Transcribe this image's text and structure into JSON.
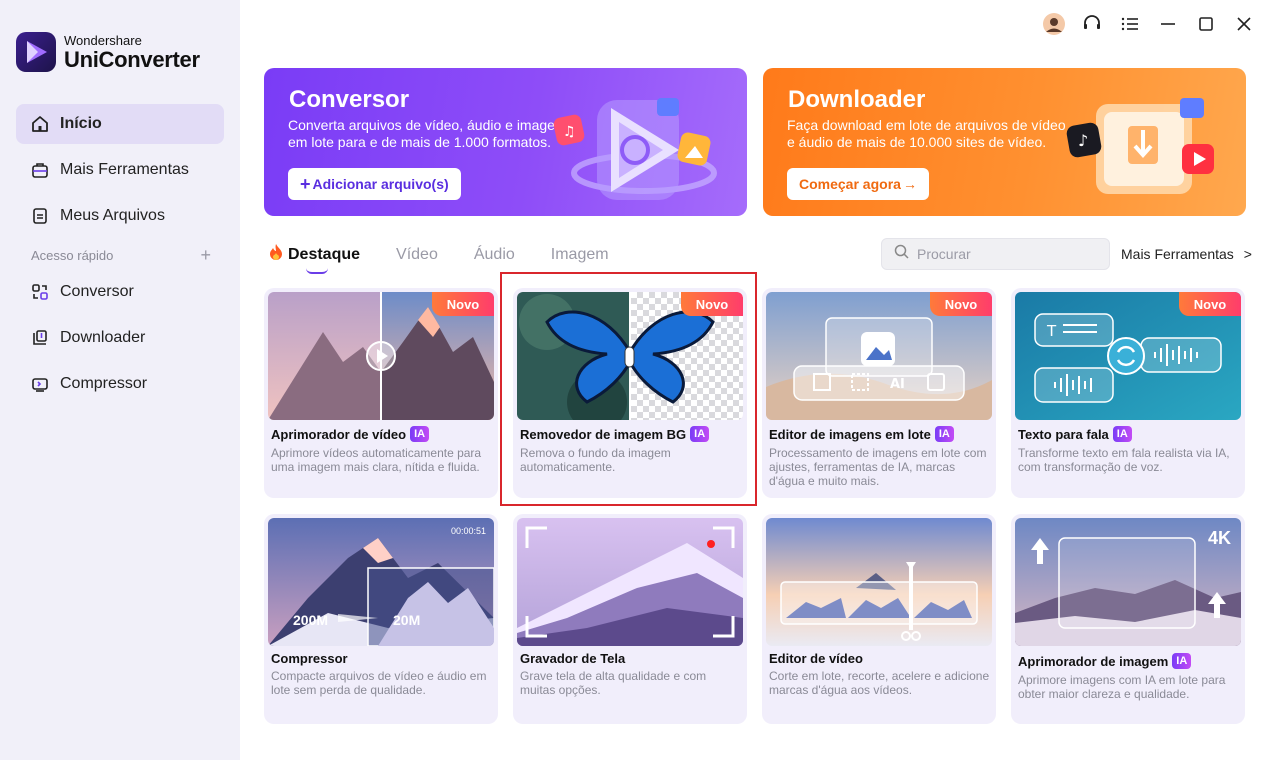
{
  "app": {
    "brand_small": "Wondershare",
    "brand_big": "UniConverter"
  },
  "sidebar": {
    "items": [
      {
        "label": "Início",
        "icon": "home-icon"
      },
      {
        "label": "Mais Ferramentas",
        "icon": "toolbox-icon"
      },
      {
        "label": "Meus Arquivos",
        "icon": "file-icon"
      }
    ],
    "quick_access_label": "Acesso rápido",
    "quick_access_add": "+",
    "quick_items": [
      {
        "label": "Conversor",
        "icon": "convert-icon"
      },
      {
        "label": "Downloader",
        "icon": "download-icon"
      },
      {
        "label": "Compressor",
        "icon": "compress-icon"
      }
    ]
  },
  "banners": {
    "converter": {
      "title": "Conversor",
      "description": "Converta arquivos de vídeo, áudio e imagem em lote para e de mais de 1.000 formatos.",
      "button": "Adicionar arquivo(s)"
    },
    "downloader": {
      "title": "Downloader",
      "description": "Faça download em lote de arquivos de vídeo e áudio de mais de 10.000 sites de vídeo.",
      "button": "Começar agora"
    }
  },
  "tabs": [
    "Destaque",
    "Vídeo",
    "Áudio",
    "Imagem"
  ],
  "search": {
    "placeholder": "Procurar"
  },
  "more_tools": "Mais Ferramentas",
  "badges": {
    "new": "Novo",
    "ai": "IA",
    "timer": "00:00:51",
    "size_before": "200M",
    "size_after": "20M",
    "res": "4K"
  },
  "cards": [
    {
      "title": "Aprimorador de vídeo",
      "ai": true,
      "new": true,
      "description": "Aprimore vídeos automaticamente para uma imagem mais clara, nítida e fluida."
    },
    {
      "title": "Removedor de imagem BG",
      "ai": true,
      "new": true,
      "description": "Remova o fundo da imagem automaticamente."
    },
    {
      "title": "Editor de imagens em lote",
      "ai": true,
      "new": true,
      "description": "Processamento de imagens em lote com ajustes, ferramentas de IA, marcas d'água e muito mais."
    },
    {
      "title": "Texto para fala",
      "ai": true,
      "new": true,
      "description": "Transforme texto em fala realista via IA, com transformação de voz."
    },
    {
      "title": "Compressor",
      "ai": false,
      "new": false,
      "description": "Compacte arquivos de vídeo e áudio em lote sem perda de qualidade."
    },
    {
      "title": "Gravador de Tela",
      "ai": false,
      "new": false,
      "description": "Grave tela de alta qualidade e com muitas opções."
    },
    {
      "title": "Editor de vídeo",
      "ai": false,
      "new": false,
      "description": "Corte em lote, recorte, acelere e adicione marcas d'água aos vídeos."
    },
    {
      "title": "Aprimorador de imagem",
      "ai": true,
      "new": false,
      "description": "Aprimore imagens com IA em lote para obter maior clareza e qualidade."
    }
  ],
  "colors": {
    "accent": "#7a3cf6",
    "downloader": "#ff8a2a",
    "highlight": "#d9262c"
  }
}
